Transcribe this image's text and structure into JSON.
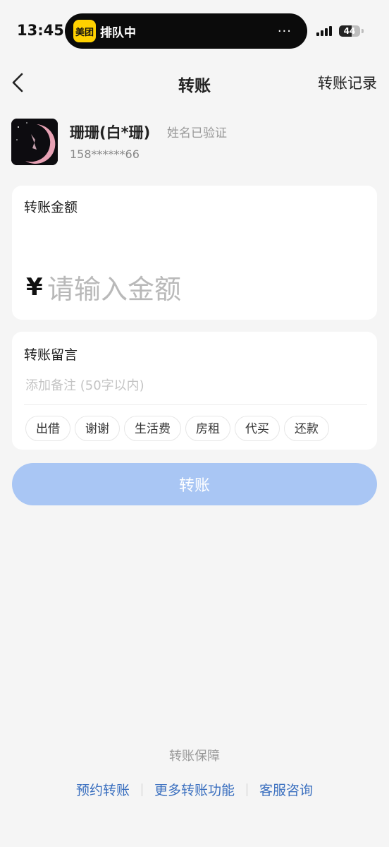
{
  "status_bar": {
    "time": "13:45",
    "island_app_logo": "美团",
    "island_text": "排队中",
    "island_more": "...",
    "battery": "44"
  },
  "nav": {
    "back_icon": "chevron-left-icon",
    "title": "转账",
    "right_link": "转账记录"
  },
  "recipient": {
    "name": "珊珊(白*珊)",
    "verified_text": "姓名已验证",
    "phone": "158******66"
  },
  "amount": {
    "label": "转账金额",
    "currency_symbol": "¥",
    "placeholder": "请输入金额",
    "value": ""
  },
  "memo": {
    "label": "转账留言",
    "placeholder": "添加备注 (50字以内)",
    "value": "",
    "chips": [
      "出借",
      "谢谢",
      "生活费",
      "房租",
      "代买",
      "还款"
    ]
  },
  "primary_button": "转账",
  "footer": {
    "guarantee": "转账保障",
    "links": [
      "预约转账",
      "更多转账功能",
      "客服咨询"
    ]
  },
  "colors": {
    "background": "#f5f5f5",
    "primary_button_disabled": "#a9c6f4",
    "link": "#3a6fbf",
    "meituan_yellow": "#ffd100"
  }
}
